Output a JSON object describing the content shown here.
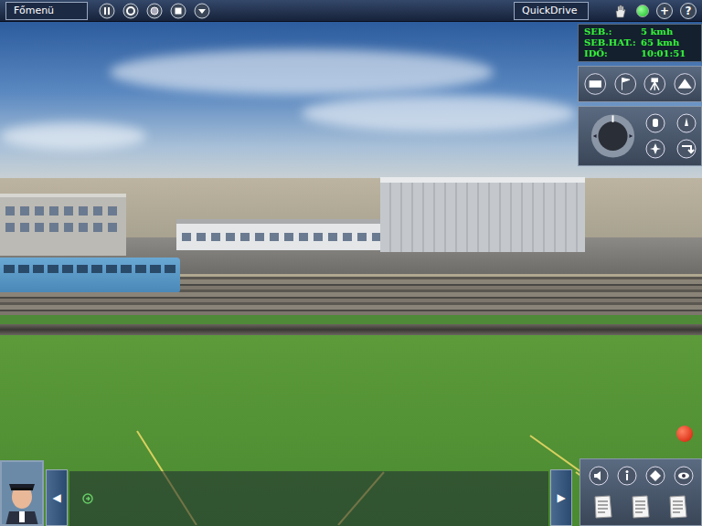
{
  "top_bar": {
    "menu_button": "Főmenü",
    "quickdrive_button": "QuickDrive",
    "add_button": "+",
    "help_button": "?",
    "status_light": {
      "on": true
    }
  },
  "info_panel": [
    {
      "label": "SEB.:",
      "value": "5 kmh"
    },
    {
      "label": "SEB.HAT.:",
      "value": "65 kmh"
    },
    {
      "label": "IDŐ:",
      "value": "10:01:51"
    }
  ],
  "record_indicator": {
    "on": true
  },
  "message_bar": {
    "prev": "◀",
    "next": "▶"
  }
}
